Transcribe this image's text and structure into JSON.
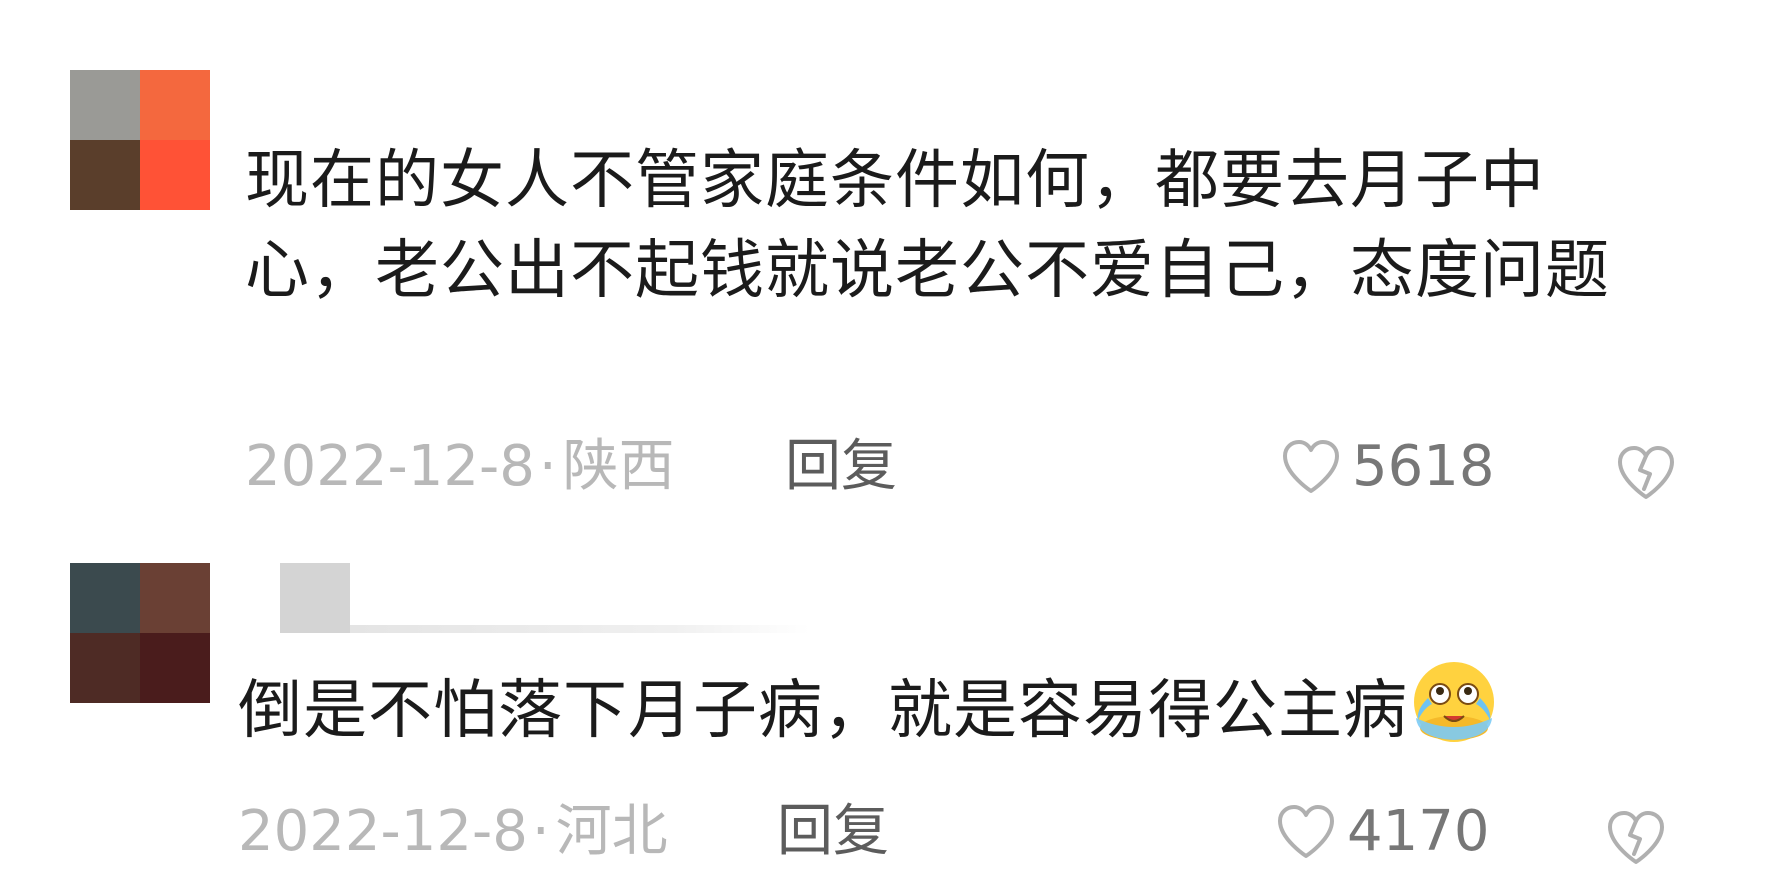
{
  "comments": [
    {
      "avatar_colors": [
        "#9a9a96",
        "#f4683e",
        "#5a3e2b",
        "#ff5236"
      ],
      "text": "现在的女人不管家庭条件如何，都要去月子中心，老公出不起钱就说老公不爱自己，态度问题",
      "date": "2022-12-8",
      "separator": "·",
      "location": "陕西",
      "reply_label": "回复",
      "likes": "5618",
      "like_icon": "heart-outline-icon",
      "dislike_icon": "broken-heart-icon"
    },
    {
      "avatar_colors": [
        "#3b4a4e",
        "#6a4034",
        "#4e2b25",
        "#4a1c1c"
      ],
      "text": "倒是不怕落下月子病，就是容易得公主病",
      "emoji": "crying-laughing-emoji",
      "date": "2022-12-8",
      "separator": "·",
      "location": "河北",
      "reply_label": "回复",
      "likes": "4170",
      "like_icon": "heart-outline-icon",
      "dislike_icon": "broken-heart-icon"
    }
  ]
}
